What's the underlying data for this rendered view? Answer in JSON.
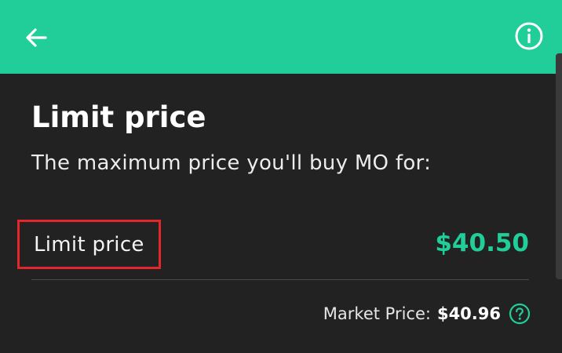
{
  "header": {
    "background_color": "#21ce99",
    "back_icon": "arrow-left-icon",
    "info_icon": "info-circle-icon"
  },
  "main": {
    "title": "Limit price",
    "subtitle": "The maximum price you'll buy MO for:",
    "limit_price_label": "Limit price",
    "limit_price_value": "$40.50",
    "market_price_label": "Market Price:",
    "market_price_value": "$40.96",
    "help_icon": "question-circle-icon"
  },
  "colors": {
    "accent": "#21ce99",
    "background": "#222222",
    "highlight_box": "#e3262b"
  }
}
